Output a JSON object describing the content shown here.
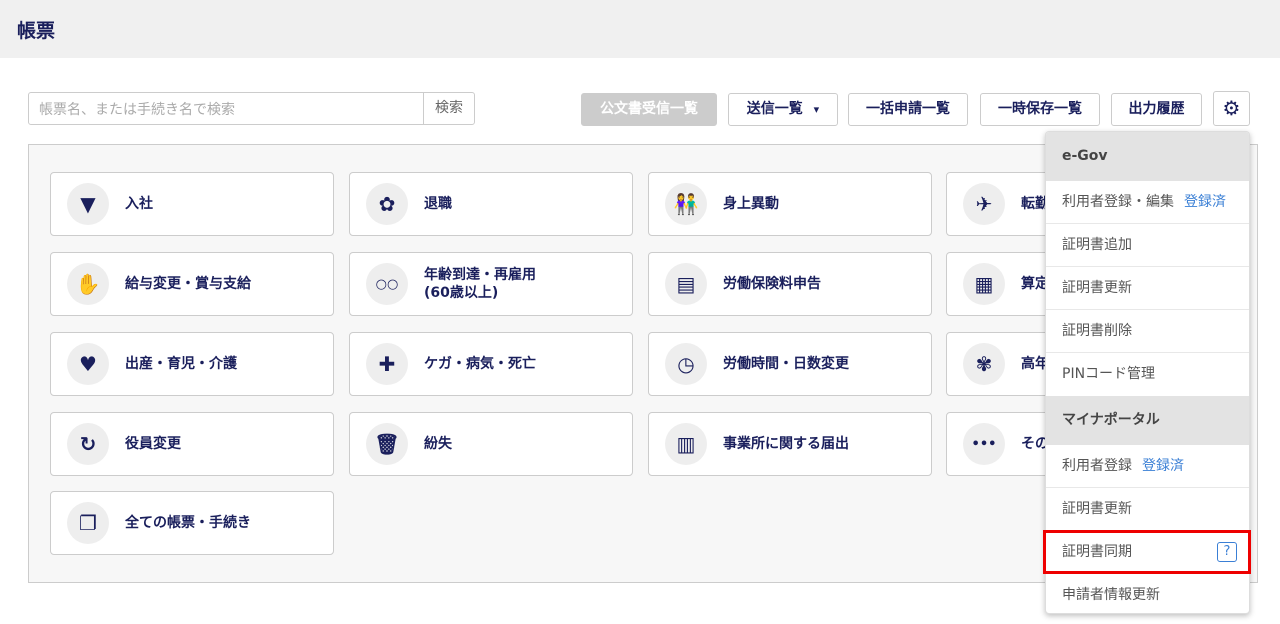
{
  "header": {
    "title": "帳票"
  },
  "search": {
    "placeholder": "帳票名、または手続き名で検索",
    "button": "検索"
  },
  "toolbar": {
    "received": "公文書受信一覧",
    "sent": "送信一覧",
    "sent_caret": "▾",
    "bulk": "一括申請一覧",
    "saved": "一時保存一覧",
    "history": "出力履歴",
    "settings_icon": "gear-icon"
  },
  "cards": [
    {
      "label": "入社",
      "icon": "necktie"
    },
    {
      "label": "退職",
      "icon": "bouquet"
    },
    {
      "label": "身上異動",
      "icon": "couple"
    },
    {
      "label": "転勤",
      "icon": "airplane"
    },
    {
      "label": "給与変更・賞与支給",
      "icon": "hand-coins"
    },
    {
      "label": "年齢到達・再雇用\n(60歳以上)",
      "icon": "glasses"
    },
    {
      "label": "労働保険料申告",
      "icon": "document"
    },
    {
      "label": "算定",
      "icon": "calculator"
    },
    {
      "label": "出産・育児・介護",
      "icon": "heart"
    },
    {
      "label": "ケガ・病気・死亡",
      "icon": "first-aid"
    },
    {
      "label": "労働時間・日数変更",
      "icon": "clock"
    },
    {
      "label": "高年",
      "icon": "maple-leaf"
    },
    {
      "label": "役員変更",
      "icon": "refresh"
    },
    {
      "label": "紛失",
      "icon": "trash"
    },
    {
      "label": "事業所に関する届出",
      "icon": "building"
    },
    {
      "label": "その",
      "icon": "ellipsis"
    },
    {
      "label": "全ての帳票・手続き",
      "icon": "documents"
    }
  ],
  "menu": {
    "egov_header": "e-Gov",
    "egov_items": [
      {
        "label": "利用者登録・編集",
        "badge": "登録済"
      },
      {
        "label": "証明書追加"
      },
      {
        "label": "証明書更新"
      },
      {
        "label": "証明書削除"
      },
      {
        "label": "PINコード管理"
      }
    ],
    "mynaportal_header": "マイナポータル",
    "myna_items": [
      {
        "label": "利用者登録",
        "badge": "登録済"
      },
      {
        "label": "証明書更新"
      },
      {
        "label": "証明書同期",
        "help": "?"
      },
      {
        "label": "申請者情報更新"
      }
    ]
  },
  "colors": {
    "navy": "#1a1f5c",
    "link": "#3a7fd5",
    "highlight": "#ee0000"
  }
}
